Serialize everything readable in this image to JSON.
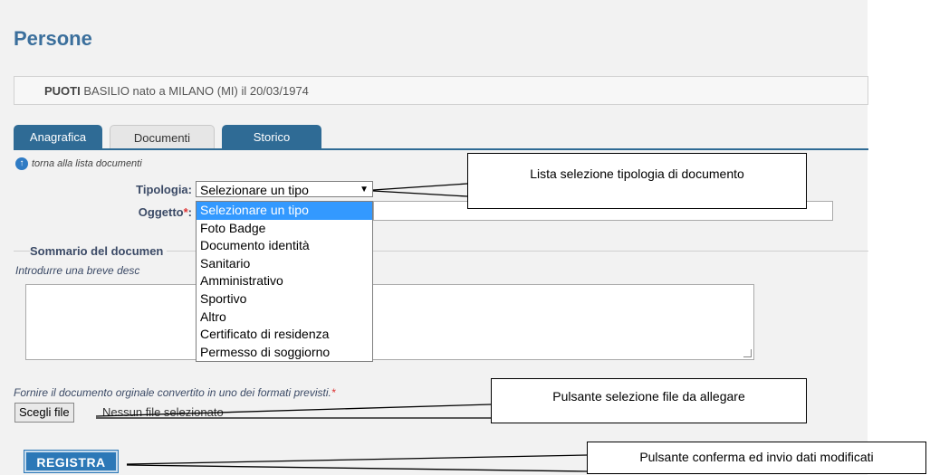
{
  "page": {
    "title": "Persone"
  },
  "person": {
    "surname": "PUOTI",
    "rest": " BASILIO nato a MILANO (MI) il 20/03/1974"
  },
  "tabs": [
    {
      "label": "Anagrafica"
    },
    {
      "label": "Documenti"
    },
    {
      "label": "Storico"
    }
  ],
  "back_link": "torna alla lista documenti",
  "form": {
    "tipologia_label": "Tipologia:",
    "oggetto_label": "Oggetto",
    "required_mark": "*",
    "oggetto_colon": ":",
    "tipologia_selected": "Selezionare un tipo",
    "tipologia_options": [
      "Selezionare un tipo",
      "Foto Badge",
      "Documento identità",
      "Sanitario",
      "Amministrativo",
      "Sportivo",
      "Altro",
      "Certificato di residenza",
      "Permesso di soggiorno"
    ],
    "summary_legend": "Sommario del documen",
    "summary_hint": "Introdurre una breve desc",
    "file_hint": "Fornire il documento orginale convertito in uno dei formati previsti.",
    "file_button": "Scegli file",
    "file_status": "Nessun file selezionato",
    "submit_label": "REGISTRA"
  },
  "callouts": {
    "tipologia": "Lista selezione tipologia di documento",
    "file": "Pulsante selezione file da allegare",
    "submit": "Pulsante conferma ed invio dati modificati"
  }
}
